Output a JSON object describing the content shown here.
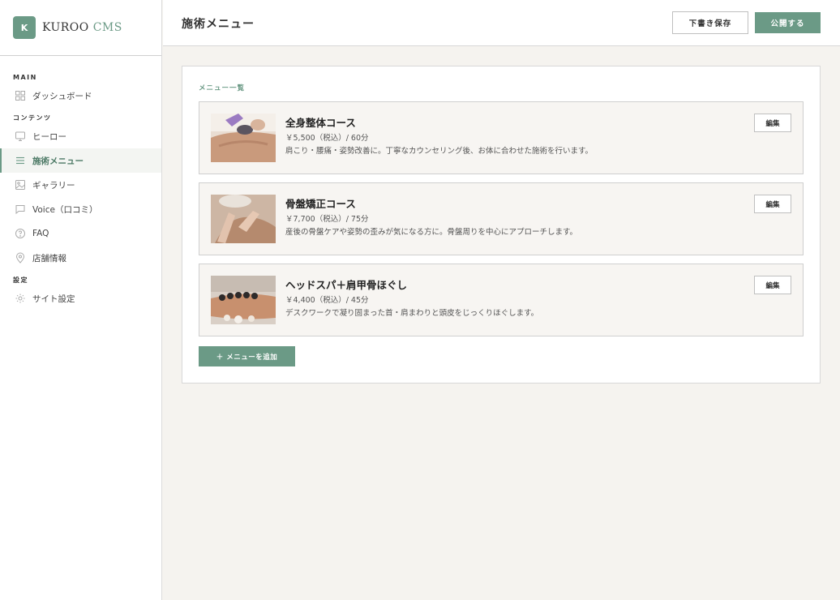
{
  "brand": {
    "logo_letter": "K",
    "name_main": "KUROO",
    "name_accent": "CMS",
    "accent_color": "#6b9a86"
  },
  "sidebar": {
    "sections": [
      {
        "label": "MAIN"
      },
      {
        "label": "コンテンツ"
      },
      {
        "label": "設定"
      }
    ],
    "items": [
      {
        "label": "ダッシュボード",
        "icon": "grid-icon"
      },
      {
        "label": "ヒーロー",
        "icon": "monitor-icon"
      },
      {
        "label": "施術メニュー",
        "icon": "list-icon",
        "active": true
      },
      {
        "label": "ギャラリー",
        "icon": "image-icon"
      },
      {
        "label": "Voice（口コミ）",
        "icon": "chat-icon"
      },
      {
        "label": "FAQ",
        "icon": "question-icon"
      },
      {
        "label": "店舗情報",
        "icon": "map-pin-icon"
      },
      {
        "label": "サイト設定",
        "icon": "gear-icon"
      }
    ]
  },
  "header": {
    "title": "施術メニュー",
    "draft_label": "下書き保存",
    "publish_label": "公開する"
  },
  "main": {
    "section_label": "メニュー一覧",
    "menus": [
      {
        "title": "全身整体コース",
        "price": "￥5,500（税込）/ 60分",
        "description": "肩こり・腰痛・姿勢改善に。丁寧なカウンセリング後、お体に合わせた施術を行います。",
        "edit_label": "編集"
      },
      {
        "title": "骨盤矯正コース",
        "price": "￥7,700（税込）/ 75分",
        "description": "産後の骨盤ケアや姿勢の歪みが気になる方に。骨盤周りを中心にアプローチします。",
        "edit_label": "編集"
      },
      {
        "title": "ヘッドスパ＋肩甲骨ほぐし",
        "price": "￥4,400（税込）/ 45分",
        "description": "デスクワークで凝り固まった首・肩まわりと頭皮をじっくりほぐします。",
        "edit_label": "編集"
      }
    ],
    "add_label": "＋ メニューを追加"
  }
}
